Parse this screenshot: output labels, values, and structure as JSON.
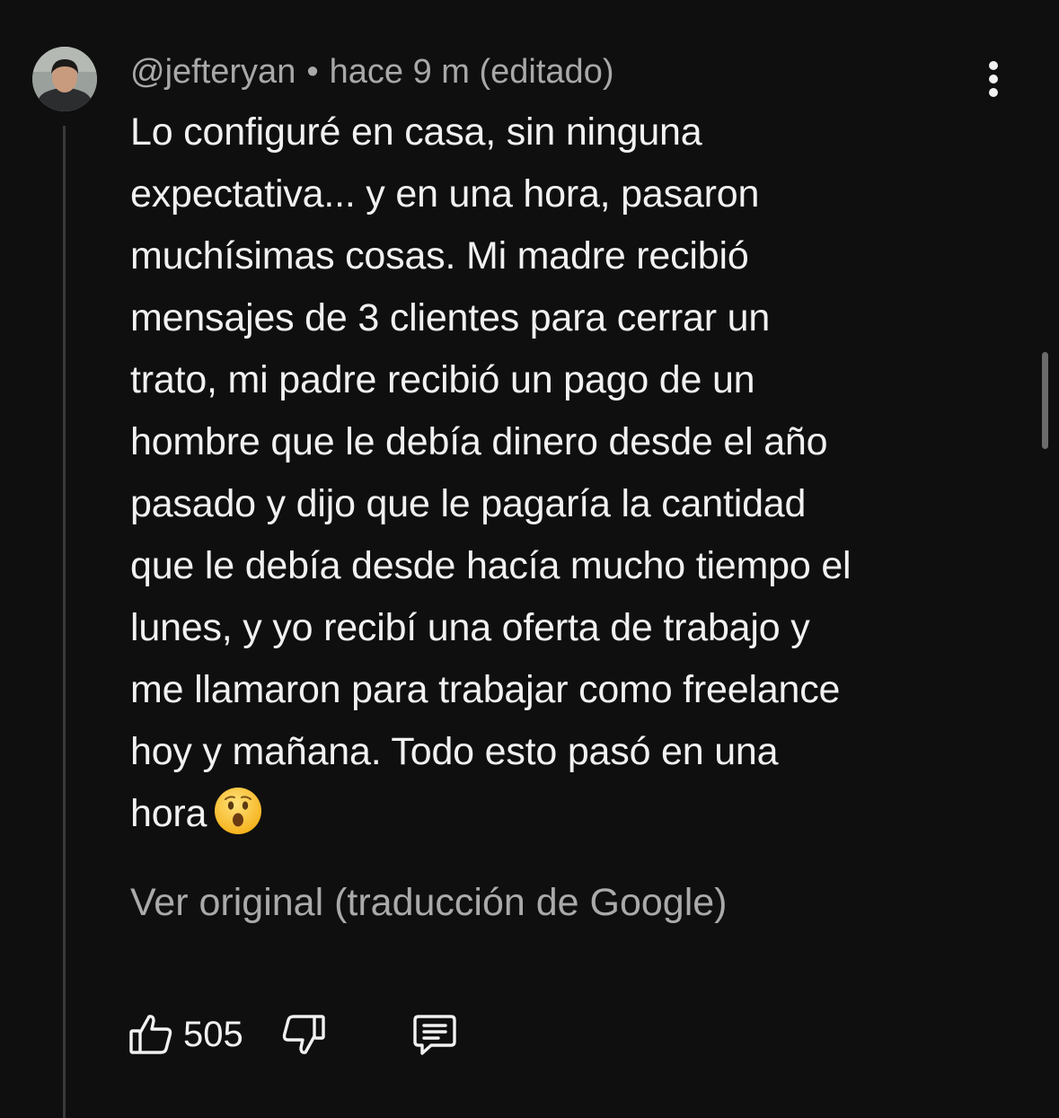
{
  "comment": {
    "author": "@jefteryan",
    "separator": "•",
    "time": "hace 9 m (editado)",
    "body_lines": [
      "Lo configuré en casa, sin ninguna",
      "expectativa... y en una hora, pasaron",
      "muchísimas cosas. Mi madre recibió",
      "mensajes de 3 clientes para cerrar un",
      "trato, mi padre recibió un pago de un",
      "hombre que le debía dinero desde el año",
      "pasado y dijo que le pagaría la cantidad",
      "que le debía desde hacía mucho tiempo el",
      "lunes, y yo recibí una oferta de trabajo y",
      "me llamaron para trabajar como freelance",
      "hoy y mañana. Todo esto pasó en una",
      "hora"
    ],
    "emoji": "astonished-face",
    "see_original": "Ver original (traducción de Google)",
    "like_count": "505"
  },
  "icons": {
    "menu": "more-vert-icon",
    "like": "thumbs-up-icon",
    "dislike": "thumbs-down-icon",
    "reply": "comment-icon"
  },
  "colors": {
    "background": "#0f0f0f",
    "text": "#f1f1f1",
    "secondary_text": "#aaaaaa"
  }
}
